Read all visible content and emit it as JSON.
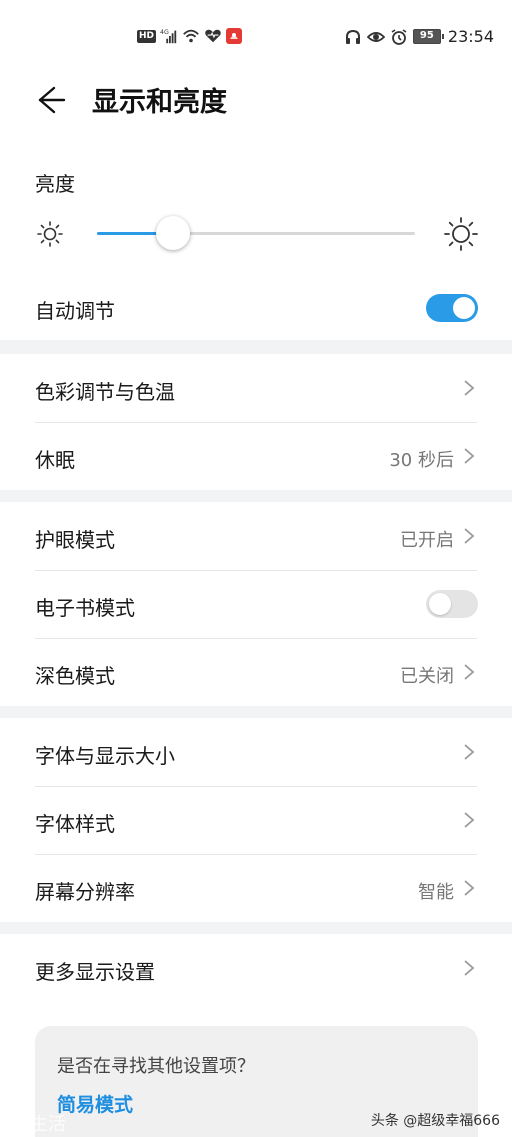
{
  "status_bar": {
    "hd": "HD",
    "network": "4G",
    "battery": "95",
    "time": "23:54",
    "icons_left": [
      "hd-badge",
      "signal-icon",
      "wifi-icon",
      "health-heart-icon",
      "app-notification-icon"
    ],
    "icons_right": [
      "headphones-icon",
      "eye-icon",
      "alarm-icon",
      "battery-icon"
    ]
  },
  "header": {
    "title": "显示和亮度"
  },
  "brightness": {
    "label": "亮度",
    "level_percent": 24,
    "auto_label": "自动调节",
    "auto_on": true
  },
  "section_color": {
    "items": [
      {
        "label": "色彩调节与色温",
        "value": ""
      },
      {
        "label": "休眠",
        "value": "30 秒后"
      }
    ]
  },
  "section_modes": {
    "eye_comfort": {
      "label": "护眼模式",
      "value": "已开启"
    },
    "ebook": {
      "label": "电子书模式",
      "on": false
    },
    "dark": {
      "label": "深色模式",
      "value": "已关闭"
    }
  },
  "section_font": {
    "items": [
      {
        "label": "字体与显示大小",
        "value": ""
      },
      {
        "label": "字体样式",
        "value": ""
      },
      {
        "label": "屏幕分辨率",
        "value": "智能"
      }
    ]
  },
  "section_more": {
    "label": "更多显示设置",
    "suggest_question": "是否在寻找其他设置项？",
    "suggest_link": "简易模式"
  },
  "watermark": {
    "left": "生活",
    "right": "头条 @超级幸福666"
  },
  "colors": {
    "accent": "#2a9be6",
    "link": "#1e8ee0",
    "background": "#f1f3f5"
  }
}
